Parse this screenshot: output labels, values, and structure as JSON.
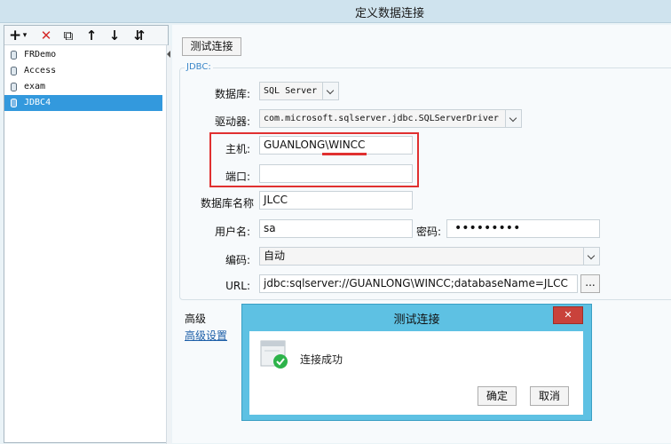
{
  "window": {
    "title": "定义数据连接"
  },
  "toolbar": {
    "add": "+",
    "add_dropdown": "▾",
    "delete": "✕",
    "copy": "⧉",
    "move_up": "↑",
    "move_down": "↓",
    "sort": "⇵"
  },
  "tree": {
    "items": [
      {
        "label": "FRDemo",
        "selected": false
      },
      {
        "label": "Access",
        "selected": false
      },
      {
        "label": "exam",
        "selected": false
      },
      {
        "label": "JDBC4",
        "selected": true
      }
    ]
  },
  "form": {
    "test_button": "测试连接",
    "jdbc_legend": "JDBC:",
    "database_label": "数据库:",
    "database_value": "SQL Server",
    "driver_label": "驱动器:",
    "driver_value": "com.microsoft.sqlserver.jdbc.SQLServerDriver",
    "host_label": "主机:",
    "host_value": "GUANLONG\\WINCC",
    "port_label": "端口:",
    "port_value": "",
    "dbname_label": "数据库名称",
    "dbname_value": "JLCC",
    "user_label": "用户名:",
    "user_value": "sa",
    "password_label": "密码:",
    "password_value": "•••••••••",
    "encoding_label": "编码:",
    "encoding_value": "自动",
    "url_label": "URL:",
    "url_value": "jdbc:sqlserver://GUANLONG\\WINCC;databaseName=JLCC",
    "url_browse": "...",
    "advanced_label": "高级",
    "advanced_link": "高级设置"
  },
  "dialog": {
    "title": "测试连接",
    "close": "✕",
    "message": "连接成功",
    "ok": "确定",
    "cancel": "取消"
  },
  "colors": {
    "highlight_red": "#e03030",
    "selection": "#3399dd",
    "dialog_frame": "#5ec1e3",
    "success_green": "#2db34a"
  }
}
